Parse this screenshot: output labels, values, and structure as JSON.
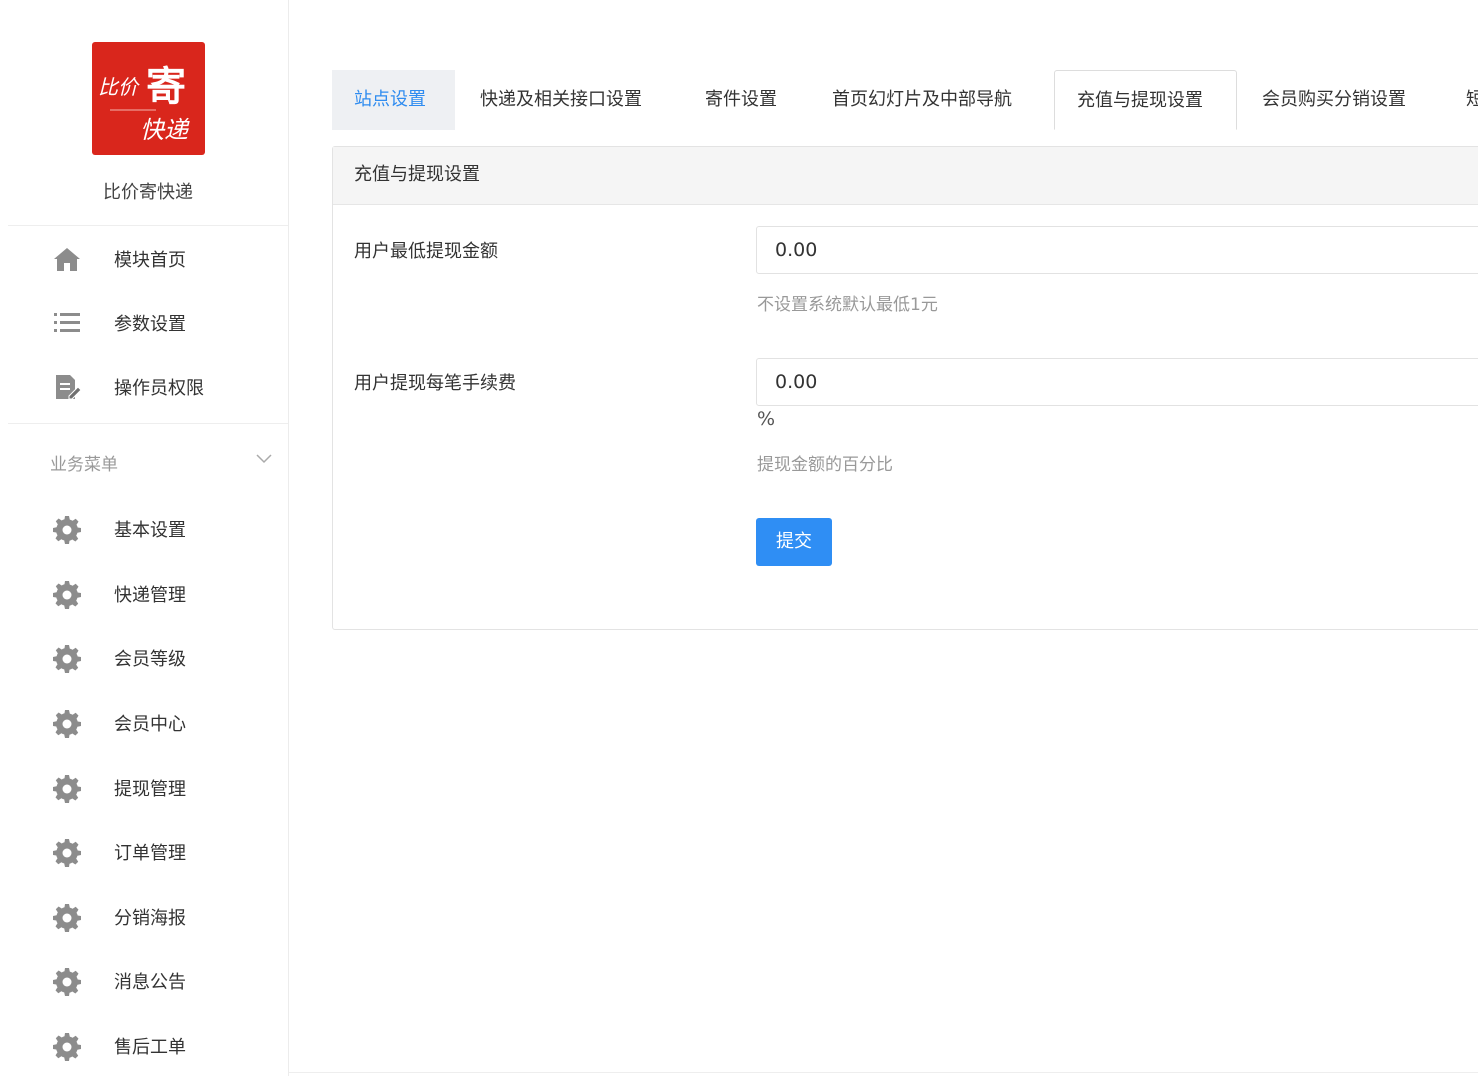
{
  "brand": {
    "name": "比价寄快递",
    "logo_text": [
      "比价",
      "寄",
      "快递"
    ]
  },
  "menu_top": [
    {
      "label": "模块首页",
      "icon": "home-icon"
    },
    {
      "label": "参数设置",
      "icon": "list-icon"
    },
    {
      "label": "操作员权限",
      "icon": "edit-document-icon"
    }
  ],
  "business_menu": {
    "title": "业务菜单",
    "items": [
      {
        "label": "基本设置",
        "icon": "gear-icon"
      },
      {
        "label": "快递管理",
        "icon": "gear-icon"
      },
      {
        "label": "会员等级",
        "icon": "gear-icon"
      },
      {
        "label": "会员中心",
        "icon": "gear-icon"
      },
      {
        "label": "提现管理",
        "icon": "gear-icon"
      },
      {
        "label": "订单管理",
        "icon": "gear-icon"
      },
      {
        "label": "分销海报",
        "icon": "gear-icon"
      },
      {
        "label": "消息公告",
        "icon": "gear-icon"
      },
      {
        "label": "售后工单",
        "icon": "gear-icon"
      }
    ]
  },
  "tabs": [
    {
      "label": "站点设置"
    },
    {
      "label": "快递及相关接口设置"
    },
    {
      "label": "寄件设置"
    },
    {
      "label": "首页幻灯片及中部导航"
    },
    {
      "label": "充值与提现设置"
    },
    {
      "label": "会员购买分销设置"
    },
    {
      "label": "短"
    }
  ],
  "panel": {
    "title": "充值与提现设置",
    "min_withdraw": {
      "label": "用户最低提现金额",
      "value": "0.00",
      "help": "不设置系统默认最低1元"
    },
    "fee": {
      "label": "用户提现每笔手续费",
      "value": "0.00",
      "unit": "%",
      "help": "提现金额的百分比"
    },
    "submit_label": "提交"
  },
  "colors": {
    "accent": "#2f8ef4",
    "logo_red": "#d9261c",
    "tab_link": "#2f8cf0"
  }
}
